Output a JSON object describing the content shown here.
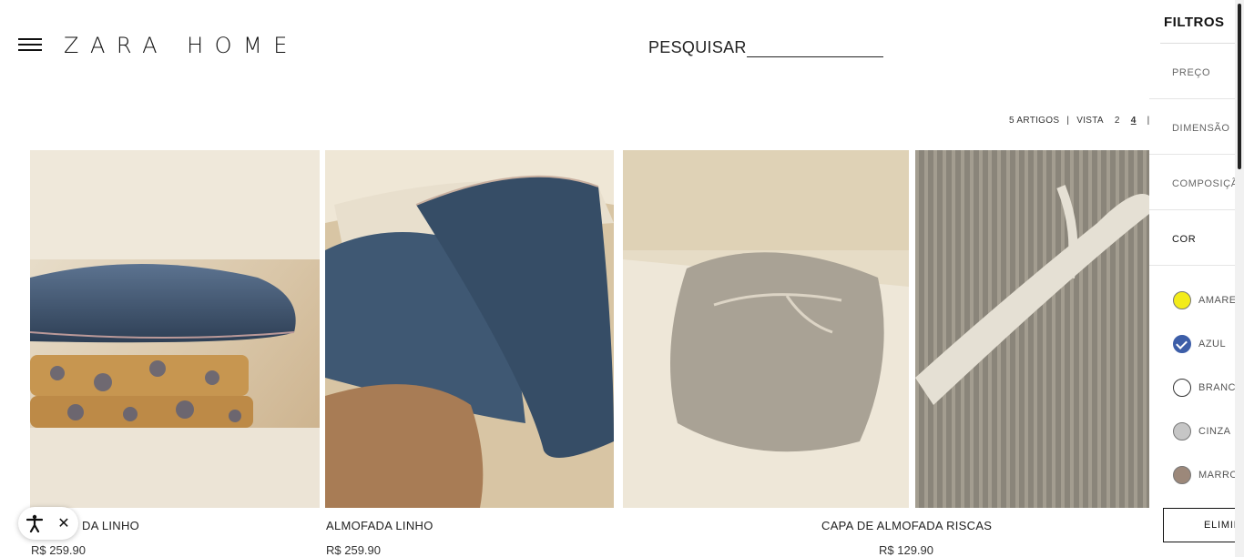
{
  "header": {
    "logo": "ZARA HOME",
    "search_label": "PESQUISAR"
  },
  "toolbar": {
    "articles": "5 ARTIGOS",
    "separator": "|",
    "view_label": "VISTA",
    "view_options": [
      "2",
      "4"
    ],
    "active_view": "4",
    "pipe": "|",
    "more": "·"
  },
  "products": [
    {
      "name": "DA LINHO",
      "price": "R$ 259.90"
    },
    {
      "name": "ALMOFADA LINHO",
      "price": "R$ 259.90"
    },
    {
      "name": "CAPA DE ALMOFADA RISCAS",
      "price": "R$ 129.90"
    }
  ],
  "filters": {
    "title": "FILTROS",
    "sections": [
      "PREÇO",
      "DIMENSÃO",
      "COMPOSIÇÃ",
      "COR"
    ],
    "colors": [
      {
        "label": "AMARE",
        "hex": "#f3ec1a",
        "checked": false
      },
      {
        "label": "AZUL",
        "hex": "#3d5ea8",
        "checked": true
      },
      {
        "label": "BRANC",
        "hex": "#ffffff",
        "checked": false
      },
      {
        "label": "CINZA",
        "hex": "#c6c6c6",
        "checked": false
      },
      {
        "label": "MARRO",
        "hex": "#9c887a",
        "checked": false
      }
    ],
    "clear_label": "ELIMIN"
  },
  "a11y": {
    "close": "✕"
  }
}
